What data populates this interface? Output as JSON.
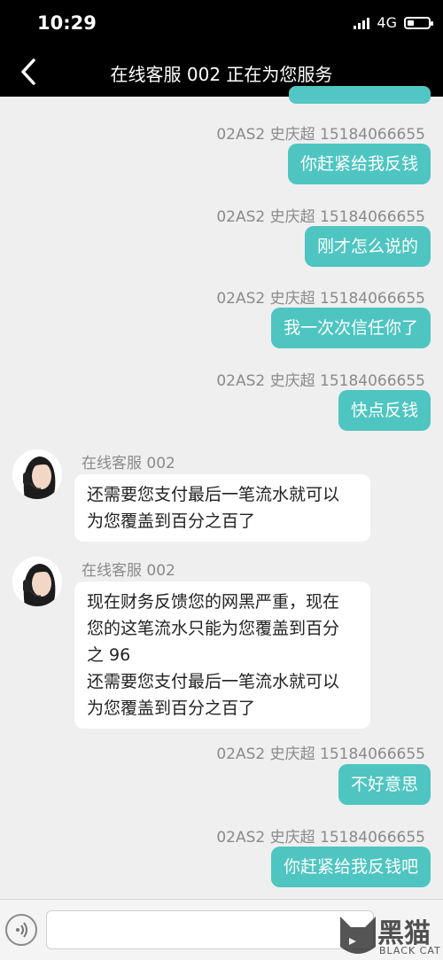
{
  "status_bar": {
    "time": "10:29",
    "network": "4G"
  },
  "header": {
    "title": "在线客服 002 正在为您服务"
  },
  "messages": [
    {
      "side": "right",
      "sender": "02AS2 史庆超 15184066655",
      "text": "你赶紧给我反钱"
    },
    {
      "side": "right",
      "sender": "02AS2 史庆超 15184066655",
      "text": "刚才怎么说的"
    },
    {
      "side": "right",
      "sender": "02AS2 史庆超 15184066655",
      "text": "我一次次信任你了"
    },
    {
      "side": "right",
      "sender": "02AS2 史庆超 15184066655",
      "text": "快点反钱"
    },
    {
      "side": "left",
      "sender": "在线客服 002",
      "text": "还需要您支付最后一笔流水就可以\n为您覆盖到百分之百了"
    },
    {
      "side": "left",
      "sender": "在线客服 002",
      "text": "现在财务反馈您的网黑严重，现在\n您的这笔流水只能为您覆盖到百分\n之 96\n还需要您支付最后一笔流水就可以\n为您覆盖到百分之百了"
    },
    {
      "side": "right",
      "sender": "02AS2 史庆超 15184066655",
      "text": "不好意思"
    },
    {
      "side": "right",
      "sender": "02AS2 史庆超 15184066655",
      "text": "你赶紧给我反钱吧"
    }
  ],
  "input": {
    "placeholder": ""
  },
  "watermark": {
    "text": "黑猫",
    "sub": "BLACK CAT"
  },
  "colors": {
    "header_bg": "#000000",
    "right_bubble": "#4ec5c1",
    "left_bubble": "#ffffff",
    "chat_bg": "#efefef"
  },
  "icons": {
    "back": "chevron-left-icon",
    "voice": "voice-icon",
    "avatar": "agent-avatar-icon"
  }
}
